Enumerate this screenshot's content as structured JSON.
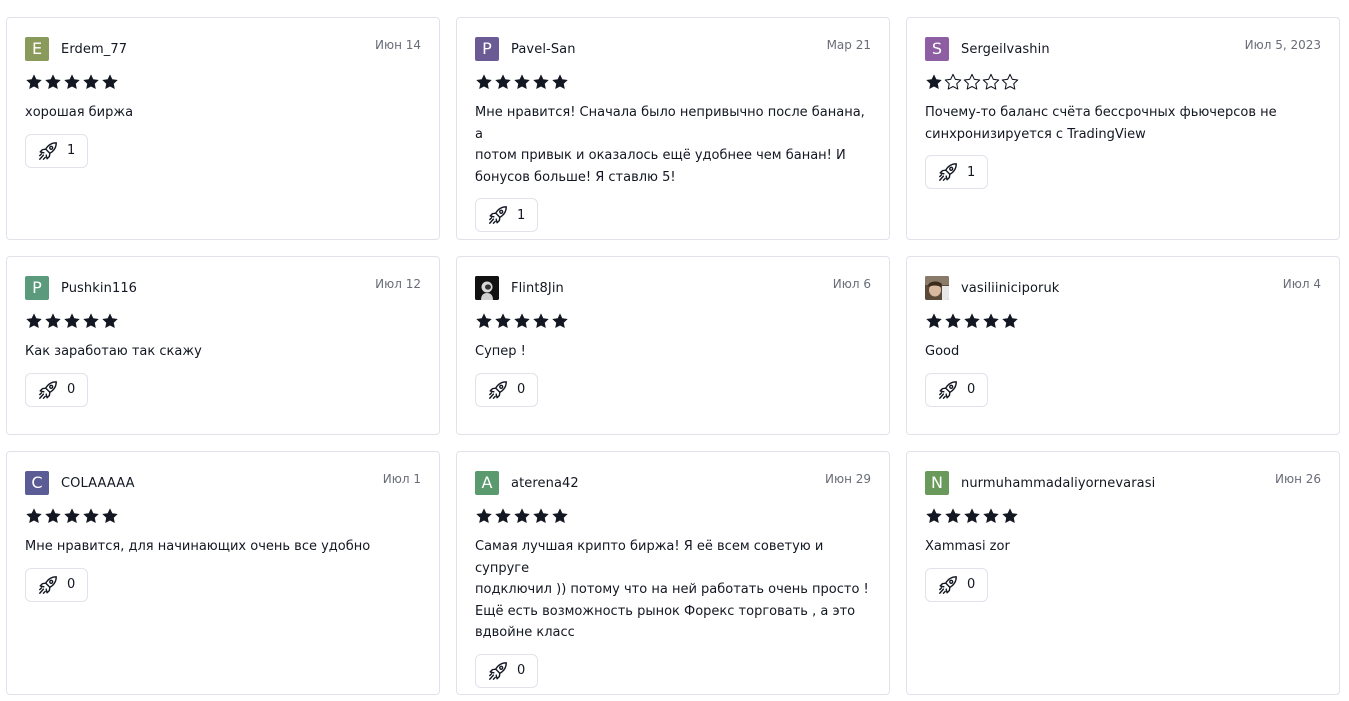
{
  "colors": {
    "border": "#e0e3eb",
    "text": "#131722",
    "muted": "#6a6d78",
    "star": "#131722"
  },
  "reviews": [
    {
      "initial": "E",
      "avatar_color": "#8a9a5b",
      "avatar_type": "letter",
      "username": "Erdem_77",
      "date": "Июн 14",
      "rating": 5,
      "text": "хорошая биржа",
      "boosts": "1"
    },
    {
      "initial": "P",
      "avatar_color": "#6b5b95",
      "avatar_type": "letter",
      "username": "Pavel-San",
      "date": "Мар 21",
      "rating": 5,
      "text": "Мне нравится! Сначала было непривычно после банана, а\nпотом привык и оказалось ещё удобнее чем банан! И\nбонусов больше! Я ставлю 5!",
      "boosts": "1"
    },
    {
      "initial": "S",
      "avatar_color": "#8e5ea2",
      "avatar_type": "letter",
      "username": "Sergeilvashin",
      "date": "Июл 5, 2023",
      "rating": 1,
      "text": "Почему-то баланс счёта бессрочных фьючерсов не\nсинхронизируется с TradingView",
      "boosts": "1"
    },
    {
      "initial": "P",
      "avatar_color": "#5b9a7a",
      "avatar_type": "letter",
      "username": "Pushkin116",
      "date": "Июл 12",
      "rating": 5,
      "text": "Как заработаю так скажу",
      "boosts": "0"
    },
    {
      "initial": "",
      "avatar_color": "#1a1a1a",
      "avatar_type": "astronaut-avatar",
      "username": "Flint8Jin",
      "date": "Июл 6",
      "rating": 5,
      "text": "Супер !",
      "boosts": "0"
    },
    {
      "initial": "",
      "avatar_color": "#7a6a5a",
      "avatar_type": "photo-avatar",
      "username": "vasiliiniciporuk",
      "date": "Июл 4",
      "rating": 5,
      "text": "Good",
      "boosts": "0"
    },
    {
      "initial": "C",
      "avatar_color": "#5b5b95",
      "avatar_type": "letter",
      "username": "COLAAAAA",
      "date": "Июл 1",
      "rating": 5,
      "text": "Мне нравится, для начинающих очень все удобно",
      "boosts": "0"
    },
    {
      "initial": "A",
      "avatar_color": "#5b9a6e",
      "avatar_type": "letter",
      "username": "aterena42",
      "date": "Июн 29",
      "rating": 5,
      "text": "Самая лучшая крипто биржа! Я её всем советую и супруге\nподключил )) потому что на ней работать очень просто !\nЕщё есть возможность рынок Форекс торговать , а это\nвдвойне класс",
      "boosts": "0"
    },
    {
      "initial": "N",
      "avatar_color": "#6a9a5b",
      "avatar_type": "letter",
      "username": "nurmuhammadaliyornevarasi",
      "date": "Июн 26",
      "rating": 5,
      "text": "Xammasi zor",
      "boosts": "0"
    }
  ]
}
